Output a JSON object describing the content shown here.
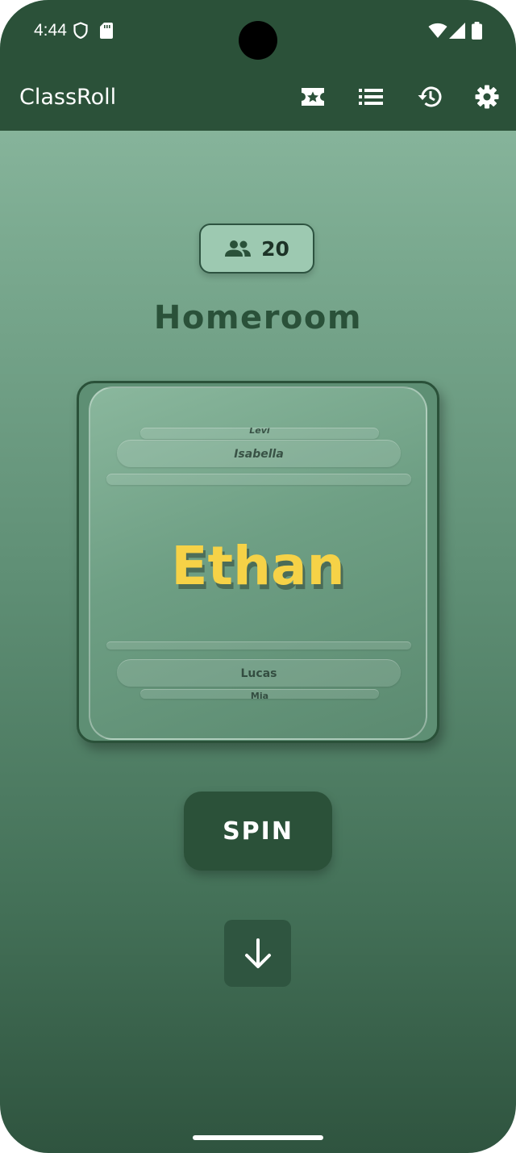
{
  "status_bar": {
    "time": "4:44",
    "icons": [
      "shield-icon",
      "sd-card-icon",
      "wifi-icon",
      "cell-signal-icon",
      "battery-icon"
    ]
  },
  "app_bar": {
    "title": "ClassRoll",
    "actions": [
      "tickets-star-icon",
      "list-icon",
      "history-icon",
      "settings-gear-icon"
    ]
  },
  "class": {
    "student_count": "20",
    "name": "Homeroom"
  },
  "wheel": {
    "above": [
      "Levi",
      "Isabella"
    ],
    "selected": "Ethan",
    "below": [
      "Lucas",
      "Mia"
    ]
  },
  "actions": {
    "spin_label": "SPIN",
    "scroll_down_icon": "arrow-down-icon"
  },
  "colors": {
    "app_bar": "#2b5139",
    "accent_name": "#f6d247",
    "button": "#2b5139",
    "background_top": "#93bfa7",
    "background_bottom": "#2f543f"
  }
}
